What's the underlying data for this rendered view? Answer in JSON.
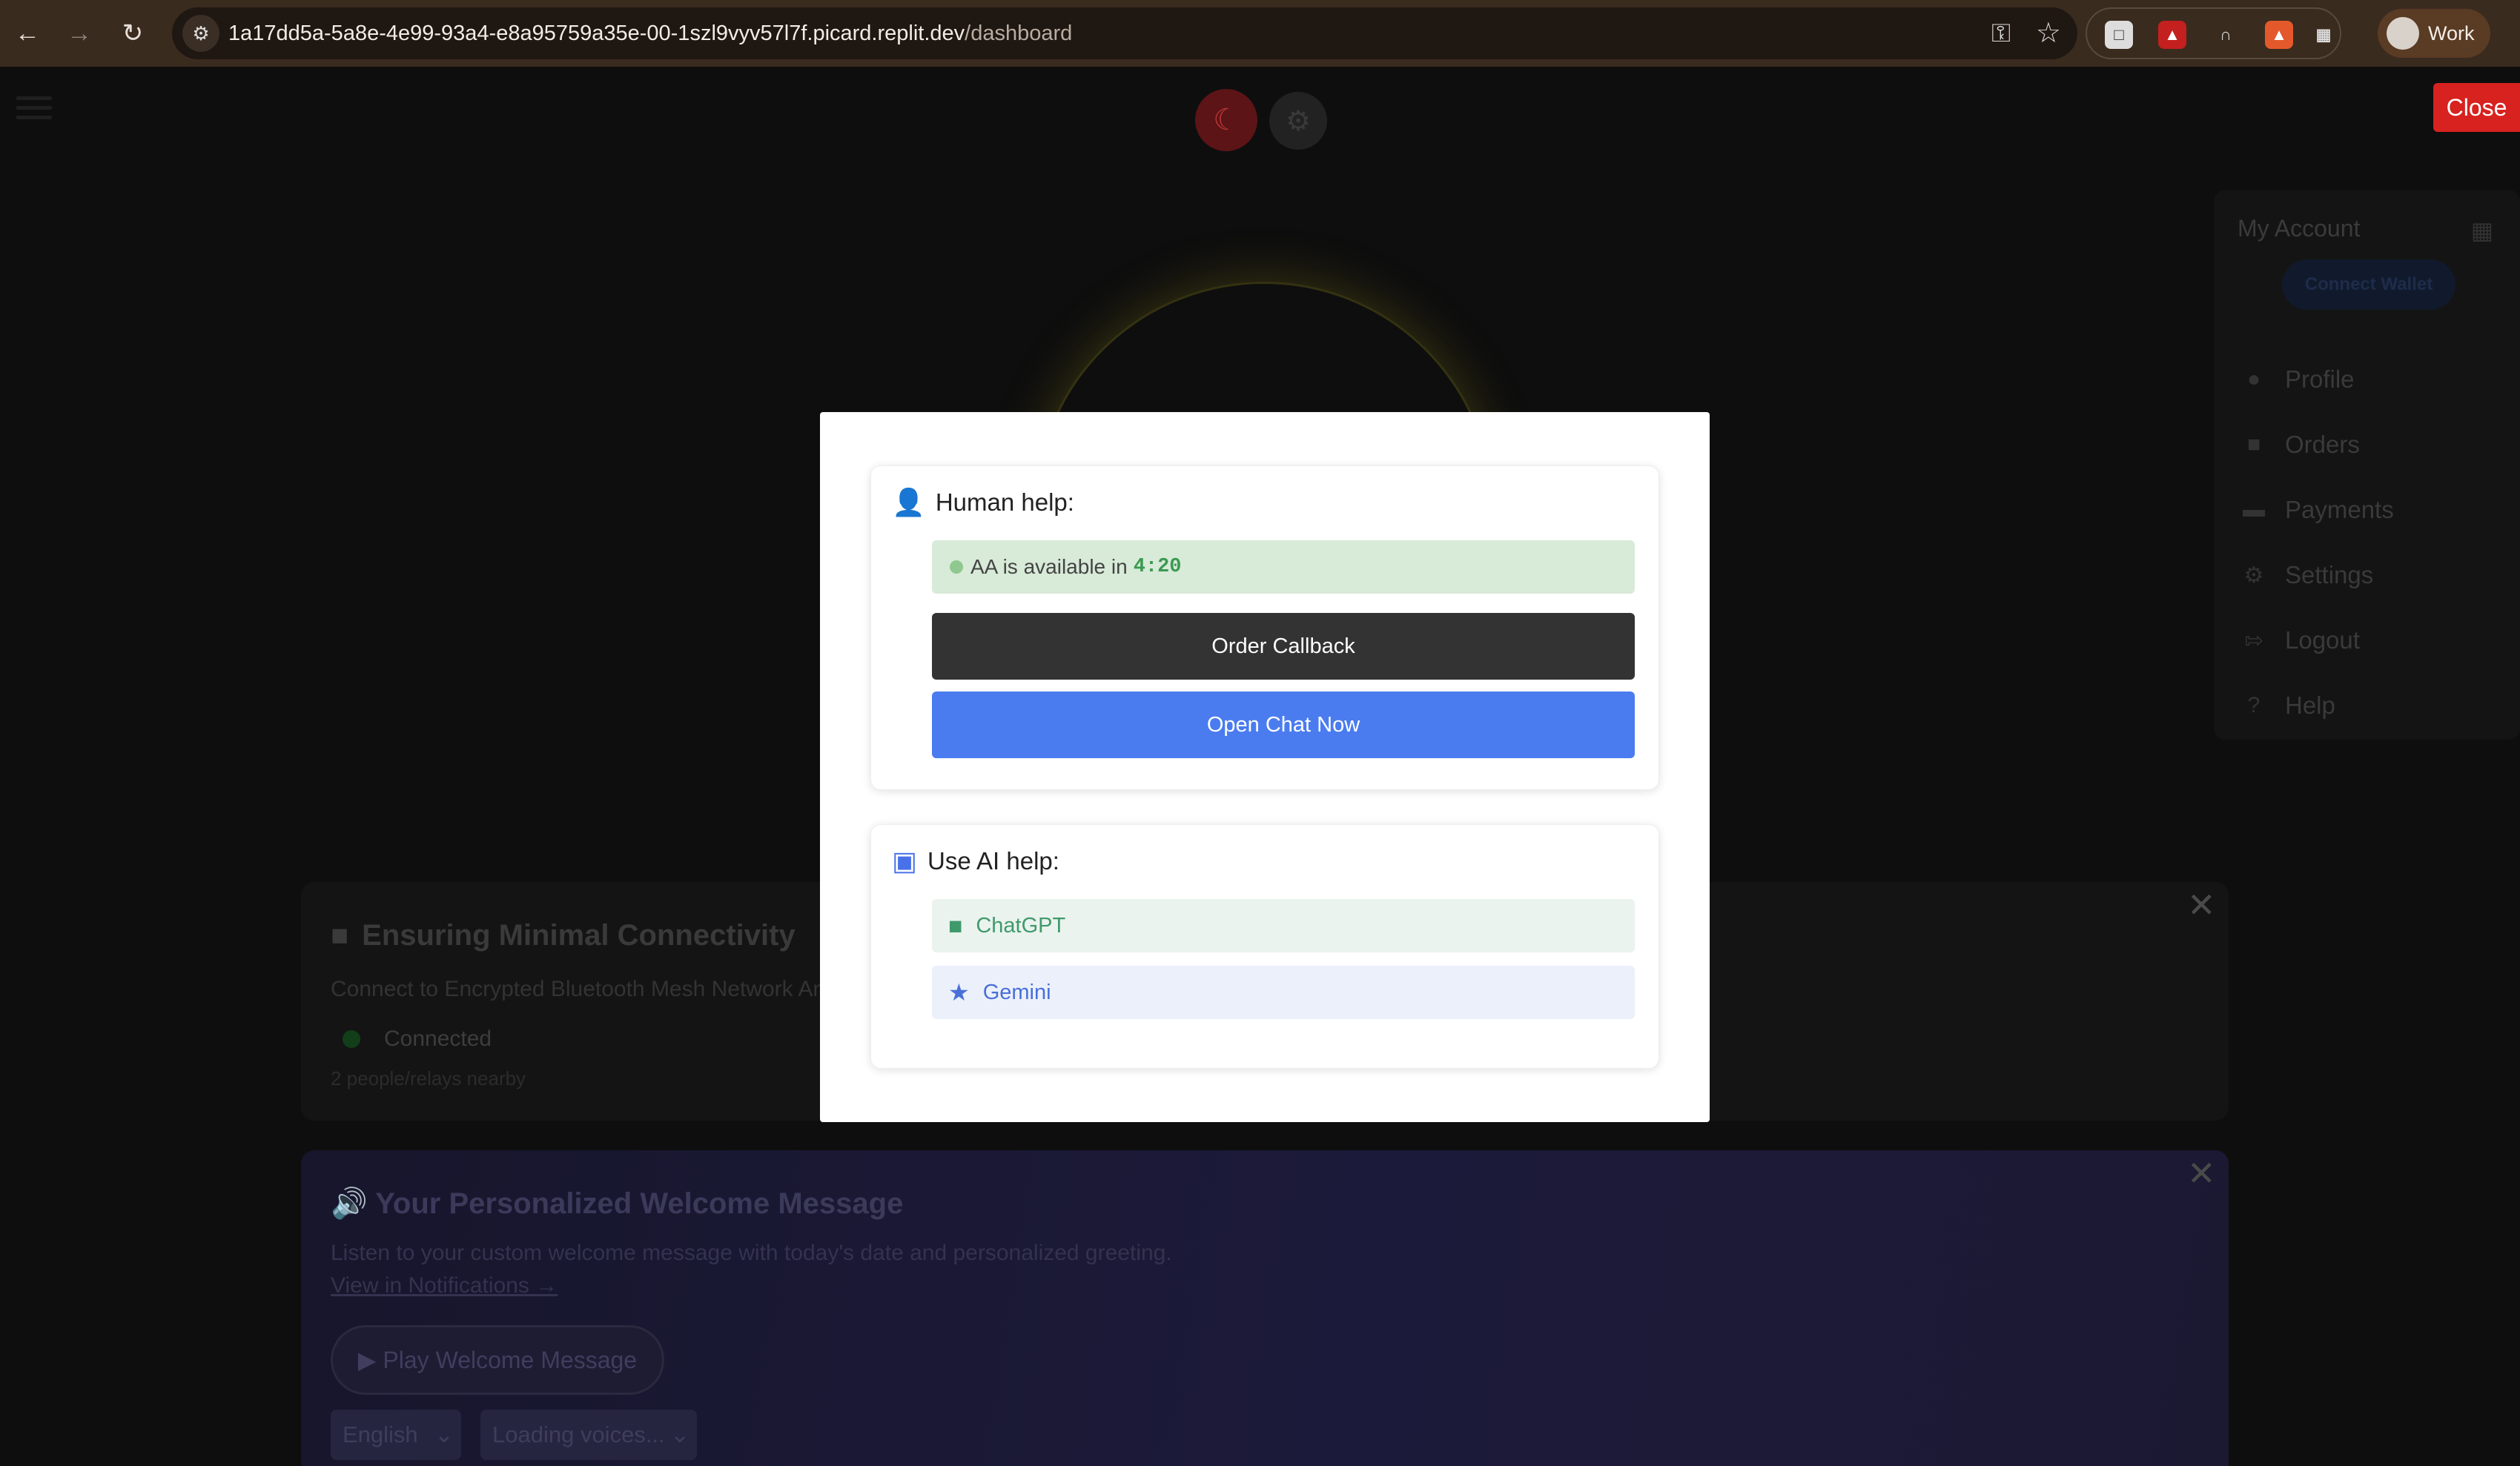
{
  "browser": {
    "url_host": "1a17dd5a-5a8e-4e99-93a4-e8a95759a35e-00-1szl9vyv57l7f.picard.replit.dev",
    "url_path": "/dashboard",
    "profile_label": "Work",
    "icons": [
      "back-icon",
      "forward-icon",
      "reload-icon",
      "site-settings-icon",
      "password-key-icon",
      "bookmark-star-icon",
      "profile-avatar"
    ]
  },
  "page": {
    "close_label": "Close",
    "account": {
      "title": "My Account",
      "wallet_label": "Connect Wallet",
      "menu": [
        {
          "label": "Profile",
          "icon": "user-icon"
        },
        {
          "label": "Orders",
          "icon": "cart-icon"
        },
        {
          "label": "Payments",
          "icon": "credit-card-icon"
        },
        {
          "label": "Settings",
          "icon": "gear-icon"
        },
        {
          "label": "Logout",
          "icon": "logout-icon"
        },
        {
          "label": "Help",
          "icon": "question-icon"
        }
      ]
    },
    "connectivity": {
      "title": "Ensuring Minimal Connectivity",
      "description": "Connect to Encrypted Bluetooth Mesh Network And",
      "status": "Connected",
      "nearby": "2 people/relays nearby"
    },
    "welcome": {
      "title": "Your Personalized Welcome Message",
      "subtitle": "Listen to your custom welcome message with today's date and personalized greeting.",
      "link": "View in Notifications →",
      "play_label": "Play Welcome Message",
      "language": "English",
      "voices": "Loading voices..."
    }
  },
  "modal": {
    "human": {
      "heading": "Human help:",
      "availability_text": "AA is available in",
      "timer": "4:20",
      "callback_label": "Order Callback",
      "chat_label": "Open Chat Now"
    },
    "ai": {
      "heading": "Use AI help:",
      "options": [
        {
          "label": "ChatGPT",
          "color": "#3f9a6b",
          "bg": "#ebf3ee"
        },
        {
          "label": "Gemini",
          "color": "#4a6fd8",
          "bg": "#ebf0fb"
        }
      ]
    }
  },
  "colors": {
    "accent_blue": "#4a7cf0",
    "close_red": "#d7221f",
    "chrome_bg": "#3a2b1f"
  }
}
